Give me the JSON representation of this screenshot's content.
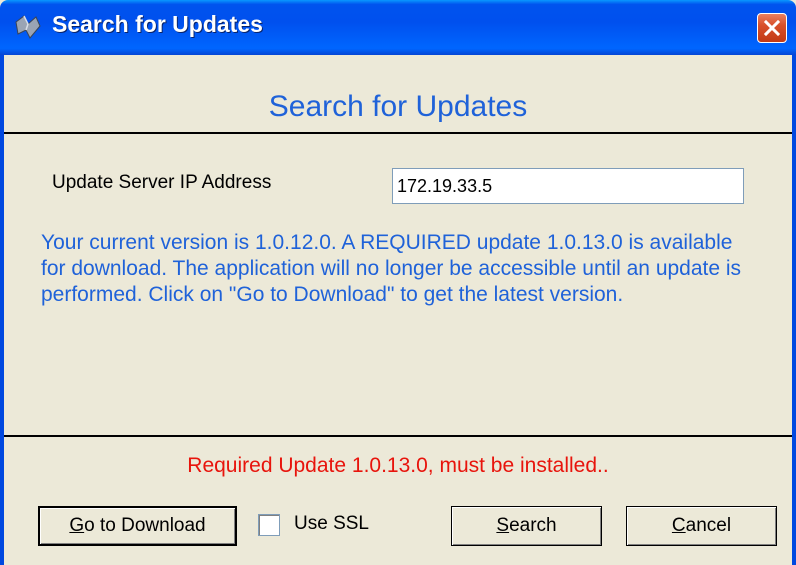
{
  "window": {
    "title": "Search for Updates",
    "icon": "app-icon",
    "close_icon": "close-icon"
  },
  "header": {
    "heading": "Search for Updates"
  },
  "server": {
    "label": "Update Server IP Address",
    "ip_value": "172.19.33.5"
  },
  "message": {
    "text": "Your current version is 1.0.12.0. A REQUIRED update 1.0.13.0 is available for download. The application will no longer be accessible until an update is performed. Click on \"Go to Download\" to get the latest version."
  },
  "status": {
    "text": "Required Update 1.0.13.0, must be installed.."
  },
  "buttons": {
    "download_mnemonic": "G",
    "download_rest": "o to Download",
    "ssl_label": "Use SSL",
    "ssl_checked": false,
    "search_mnemonic": "S",
    "search_rest": "earch",
    "cancel_mnemonic": "C",
    "cancel_rest": "ancel"
  },
  "colors": {
    "titlebar": "#0050ee",
    "heading_text": "#1f62d9",
    "status_text": "#e8140c",
    "dialog_bg": "#ece9d8"
  }
}
